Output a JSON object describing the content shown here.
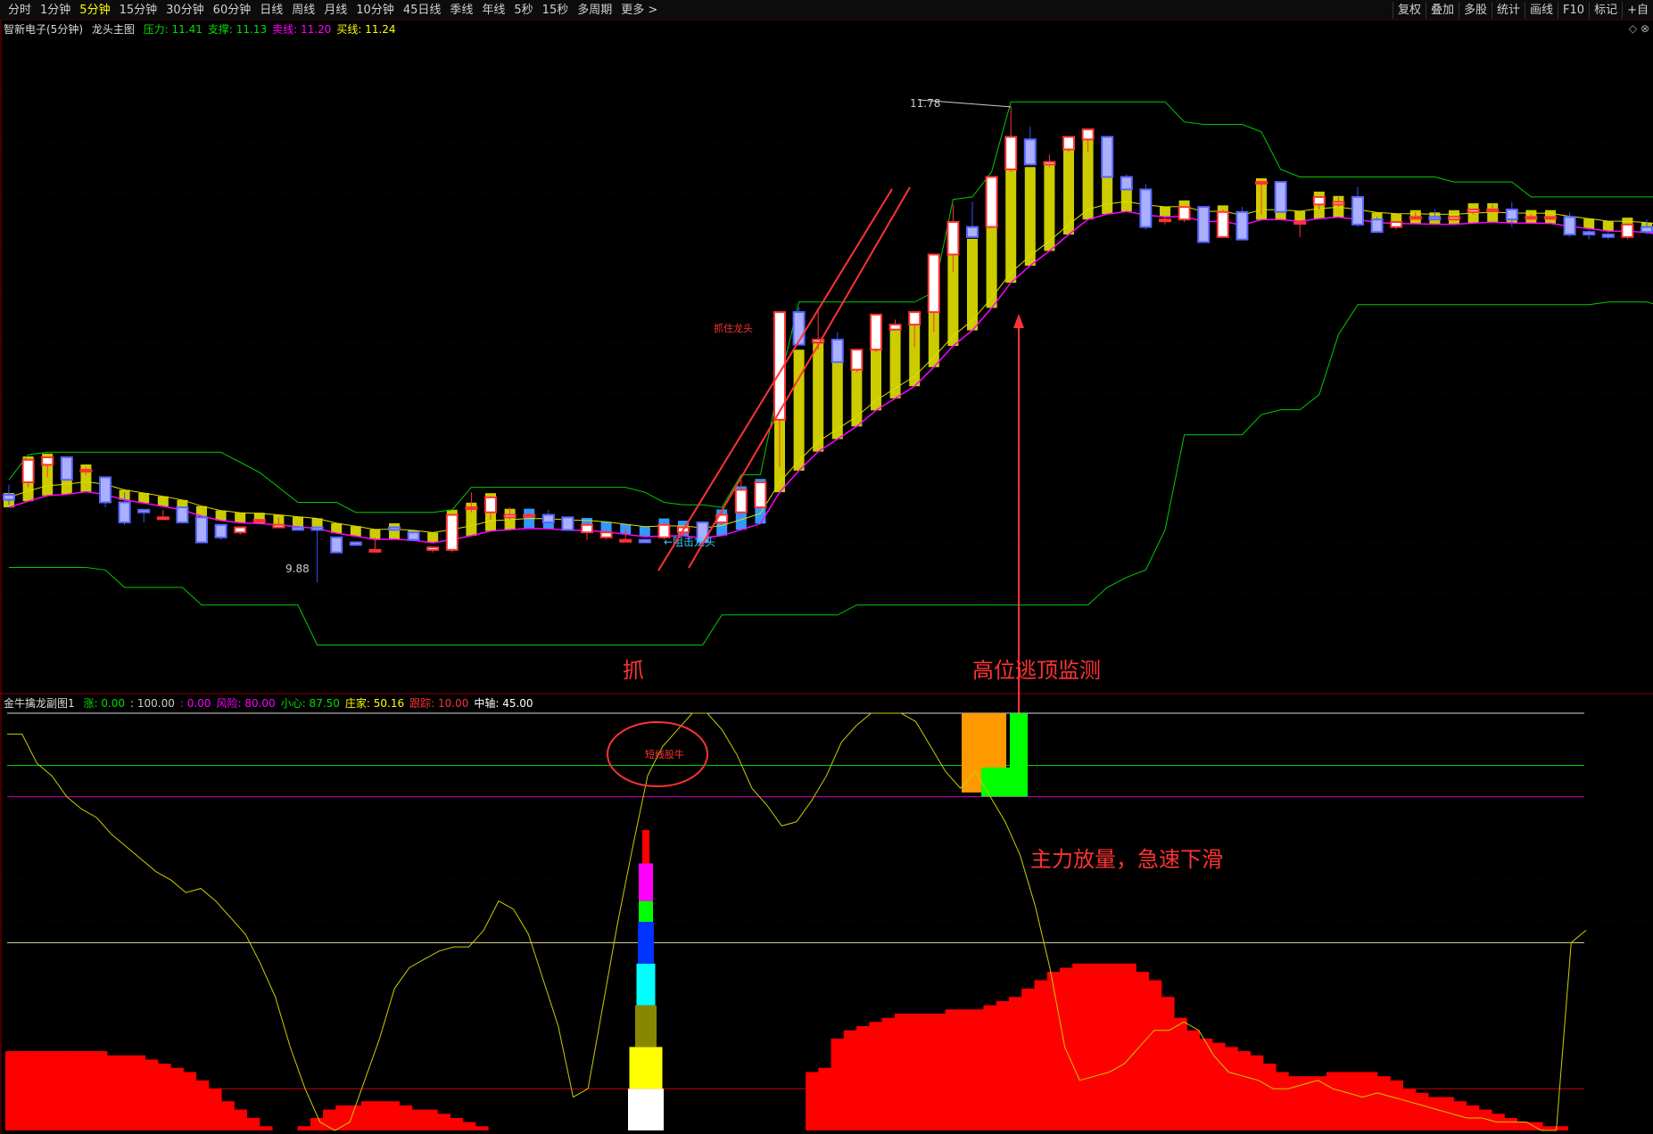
{
  "toolbar": {
    "periods": [
      "分时",
      "1分钟",
      "5分钟",
      "15分钟",
      "30分钟",
      "60分钟",
      "日线",
      "周线",
      "月线",
      "10分钟",
      "45日线",
      "季线",
      "年线",
      "5秒",
      "15秒",
      "多周期",
      "更多 >"
    ],
    "active_period": "5分钟",
    "tools": [
      "复权",
      "叠加",
      "多股",
      "统计",
      "画线",
      "F10",
      "标记",
      "+自"
    ]
  },
  "main_legend": {
    "stock": "智新电子(5分钟)",
    "indicator": "龙头主图",
    "items": [
      {
        "label": "压力: 11.41",
        "color": "#00dd00"
      },
      {
        "label": "支撑: 11.13",
        "color": "#00dd00"
      },
      {
        "label": "卖线: 11.20",
        "color": "#ff00ff"
      },
      {
        "label": "买线: 11.24",
        "color": "#ffff00"
      }
    ]
  },
  "sub_legend": {
    "indicator": "金牛擒龙副图1",
    "items": [
      {
        "label": "涨: 0.00",
        "color": "#00dd00"
      },
      {
        "label": ": 100.00",
        "color": "#cccccc"
      },
      {
        "label": ": 0.00",
        "color": "#ff00ff"
      },
      {
        "label": "风险: 80.00",
        "color": "#ff00ff"
      },
      {
        "label": "小心: 87.50",
        "color": "#00dd00"
      },
      {
        "label": "庄家: 50.16",
        "color": "#ffff00"
      },
      {
        "label": "跟踪: 10.00",
        "color": "#ff3333"
      },
      {
        "label": "中轴: 45.00",
        "color": "#ffffff"
      }
    ]
  },
  "annotations": {
    "high_label": "11.78",
    "low_label": "9.88",
    "block_dragon": "←阻击龙头",
    "dragon_tag": "抓住龙头",
    "grab": "抓",
    "top_escape": "高位逃顶监测",
    "short_line": "短线股牛",
    "main_force": "主力放量，急速下滑"
  },
  "chart_data": [
    {
      "type": "candlestick",
      "title": "龙头主图",
      "ylim": [
        9.5,
        12.1
      ],
      "high_marker": 11.78,
      "low_marker": 9.88,
      "candles": [
        [
          10.23,
          10.27,
          10.19,
          10.21
        ],
        [
          10.28,
          10.37,
          10.26,
          10.37
        ],
        [
          10.35,
          10.38,
          10.3,
          10.38
        ],
        [
          10.38,
          10.38,
          10.29,
          10.29
        ],
        [
          10.33,
          10.34,
          10.31,
          10.33
        ],
        [
          10.3,
          10.3,
          10.18,
          10.2
        ],
        [
          10.2,
          10.24,
          10.11,
          10.12
        ],
        [
          10.17,
          10.17,
          10.12,
          10.16
        ],
        [
          10.14,
          10.17,
          10.14,
          10.14
        ],
        [
          10.18,
          10.18,
          10.12,
          10.12
        ],
        [
          10.14,
          10.14,
          10.04,
          10.04
        ],
        [
          10.11,
          10.11,
          10.05,
          10.06
        ],
        [
          10.08,
          10.1,
          10.07,
          10.1
        ],
        [
          10.13,
          10.13,
          10.12,
          10.13
        ],
        [
          10.1,
          10.14,
          10.1,
          10.11
        ],
        [
          10.1,
          10.1,
          10.09,
          10.09
        ],
        [
          10.1,
          10.1,
          9.88,
          10.09
        ],
        [
          10.06,
          10.06,
          10.04,
          10.0
        ],
        [
          10.04,
          10.04,
          10.03,
          10.03
        ],
        [
          10.01,
          10.06,
          10.0,
          10.01
        ],
        [
          10.1,
          10.1,
          10.09,
          10.09
        ],
        [
          10.08,
          10.08,
          10.05,
          10.05
        ],
        [
          10.01,
          10.02,
          10.0,
          10.02
        ],
        [
          10.01,
          10.15,
          10.0,
          10.15
        ],
        [
          10.18,
          10.24,
          10.16,
          10.18
        ],
        [
          10.16,
          10.22,
          10.13,
          10.22
        ],
        [
          10.14,
          10.18,
          10.13,
          10.15
        ],
        [
          10.15,
          10.16,
          10.15,
          10.15
        ],
        [
          10.15,
          10.17,
          10.14,
          10.12
        ],
        [
          10.14,
          10.14,
          10.09,
          10.09
        ],
        [
          10.08,
          10.12,
          10.05,
          10.11
        ],
        [
          10.06,
          10.09,
          10.05,
          10.08
        ],
        [
          10.05,
          10.1,
          10.04,
          10.05
        ],
        [
          10.05,
          10.05,
          10.04,
          10.04
        ],
        [
          10.06,
          10.12,
          10.05,
          10.11
        ],
        [
          10.08,
          10.1,
          10.07,
          10.1
        ],
        [
          10.12,
          10.12,
          10.04,
          10.04
        ],
        [
          10.12,
          10.16,
          10.11,
          10.15
        ],
        [
          10.16,
          10.29,
          10.15,
          10.25
        ],
        [
          10.18,
          10.28,
          10.18,
          10.28
        ],
        [
          10.53,
          10.66,
          10.34,
          10.96
        ],
        [
          10.96,
          10.98,
          10.84,
          10.83
        ],
        [
          10.84,
          10.97,
          10.81,
          10.85
        ],
        [
          10.85,
          10.88,
          10.76,
          10.76
        ],
        [
          10.73,
          10.81,
          10.72,
          10.81
        ],
        [
          10.81,
          10.95,
          10.8,
          10.95
        ],
        [
          10.89,
          10.93,
          10.89,
          10.91
        ],
        [
          10.91,
          10.96,
          10.82,
          10.96
        ],
        [
          10.96,
          11.02,
          10.88,
          11.19
        ],
        [
          11.19,
          11.39,
          11.12,
          11.32
        ],
        [
          11.3,
          11.4,
          11.26,
          11.26
        ],
        [
          11.3,
          11.5,
          11.3,
          11.5
        ],
        [
          11.53,
          11.78,
          11.52,
          11.66
        ],
        [
          11.65,
          11.7,
          11.55,
          11.55
        ],
        [
          11.55,
          11.59,
          11.54,
          11.56
        ],
        [
          11.61,
          11.65,
          11.6,
          11.66
        ],
        [
          11.65,
          11.69,
          11.6,
          11.69
        ],
        [
          11.66,
          11.66,
          11.5,
          11.5
        ],
        [
          11.5,
          11.51,
          11.45,
          11.45
        ],
        [
          11.45,
          11.47,
          11.29,
          11.3
        ],
        [
          11.33,
          11.34,
          11.31,
          11.33
        ],
        [
          11.33,
          11.38,
          11.32,
          11.38
        ],
        [
          11.38,
          11.38,
          11.24,
          11.24
        ],
        [
          11.26,
          11.37,
          11.26,
          11.36
        ],
        [
          11.36,
          11.38,
          11.25,
          11.25
        ],
        [
          11.48,
          11.48,
          11.35,
          11.48
        ],
        [
          11.48,
          11.48,
          11.36,
          11.36
        ],
        [
          11.32,
          11.32,
          11.26,
          11.32
        ],
        [
          11.39,
          11.42,
          11.37,
          11.42
        ],
        [
          11.39,
          11.42,
          11.38,
          11.4
        ],
        [
          11.42,
          11.46,
          11.3,
          11.31
        ],
        [
          11.33,
          11.34,
          11.29,
          11.28
        ],
        [
          11.3,
          11.31,
          11.29,
          11.32
        ],
        [
          11.34,
          11.36,
          11.33,
          11.34
        ],
        [
          11.34,
          11.37,
          11.33,
          11.33
        ],
        [
          11.33,
          11.33,
          11.33,
          11.34
        ],
        [
          11.36,
          11.36,
          11.35,
          11.37
        ],
        [
          11.37,
          11.39,
          11.36,
          11.37
        ],
        [
          11.37,
          11.4,
          11.3,
          11.33
        ],
        [
          11.34,
          11.35,
          11.33,
          11.34
        ],
        [
          11.34,
          11.34,
          11.34,
          11.34
        ],
        [
          11.34,
          11.36,
          11.26,
          11.27
        ],
        [
          11.28,
          11.29,
          11.25,
          11.27
        ],
        [
          11.27,
          11.28,
          11.25,
          11.26
        ],
        [
          11.26,
          11.31,
          11.25,
          11.31
        ],
        [
          11.3,
          11.33,
          11.27,
          11.28
        ],
        [
          11.28,
          11.28,
          11.23,
          11.23
        ],
        [
          11.23,
          11.23,
          11.2,
          11.21
        ],
        [
          11.23,
          11.29,
          11.22,
          11.29
        ],
        [
          11.3,
          11.46,
          11.29,
          11.48
        ],
        [
          11.48,
          11.48,
          11.38,
          11.35
        ]
      ]
    },
    {
      "type": "area",
      "title": "金牛擒龙副图1",
      "ylim": [
        0,
        100
      ],
      "levels": {
        "top": 100,
        "caution": 87.5,
        "risk": 80,
        "mid": 45,
        "track": 10
      },
      "main_force": [
        19,
        19,
        19,
        19,
        19,
        19,
        19,
        19,
        18,
        18,
        18,
        17,
        16,
        15,
        14,
        12,
        10,
        7,
        5,
        3,
        1,
        0,
        0,
        1,
        3,
        5,
        6,
        6,
        7,
        7,
        7,
        6,
        5,
        5,
        4,
        3,
        2,
        1,
        0,
        0,
        0,
        0,
        0,
        0,
        0,
        0,
        0,
        0,
        0,
        0,
        0,
        0,
        0,
        0,
        0,
        0,
        0,
        0,
        0,
        0,
        0,
        0,
        0,
        14,
        15,
        22,
        24,
        25,
        26,
        27,
        28,
        28,
        28,
        28,
        29,
        29,
        29,
        30,
        31,
        32,
        34,
        36,
        38,
        39,
        40,
        40,
        40,
        40,
        40,
        38,
        36,
        32,
        27,
        24,
        22,
        21,
        20,
        19,
        18,
        16,
        14,
        13,
        13,
        13,
        14,
        14,
        14,
        14,
        13,
        12,
        10,
        9,
        8,
        8,
        7,
        6,
        5,
        4,
        3,
        2,
        2,
        1,
        1,
        0,
        0
      ],
      "yellow_line": [
        95,
        95,
        88,
        85,
        80,
        77,
        75,
        71,
        68,
        65,
        62,
        60,
        57,
        58,
        55,
        51,
        47,
        40,
        32,
        20,
        10,
        2,
        0,
        2,
        12,
        22,
        34,
        39,
        41,
        43,
        44,
        44,
        48,
        55,
        53,
        47,
        36,
        25,
        8,
        10,
        30,
        50,
        68,
        85,
        92,
        96,
        100,
        100,
        96,
        90,
        82,
        78,
        73,
        74,
        79,
        85,
        93,
        97,
        100,
        100,
        100,
        98,
        92,
        86,
        82,
        86,
        80,
        74,
        66,
        54,
        39,
        20,
        12,
        13,
        14,
        16,
        20,
        24,
        24,
        26,
        24,
        18,
        14,
        13,
        12,
        10,
        10,
        11,
        12,
        10,
        9,
        8,
        9,
        8,
        7,
        6,
        5,
        4,
        3,
        3,
        2,
        2,
        2,
        0,
        0,
        45,
        48
      ]
    }
  ]
}
